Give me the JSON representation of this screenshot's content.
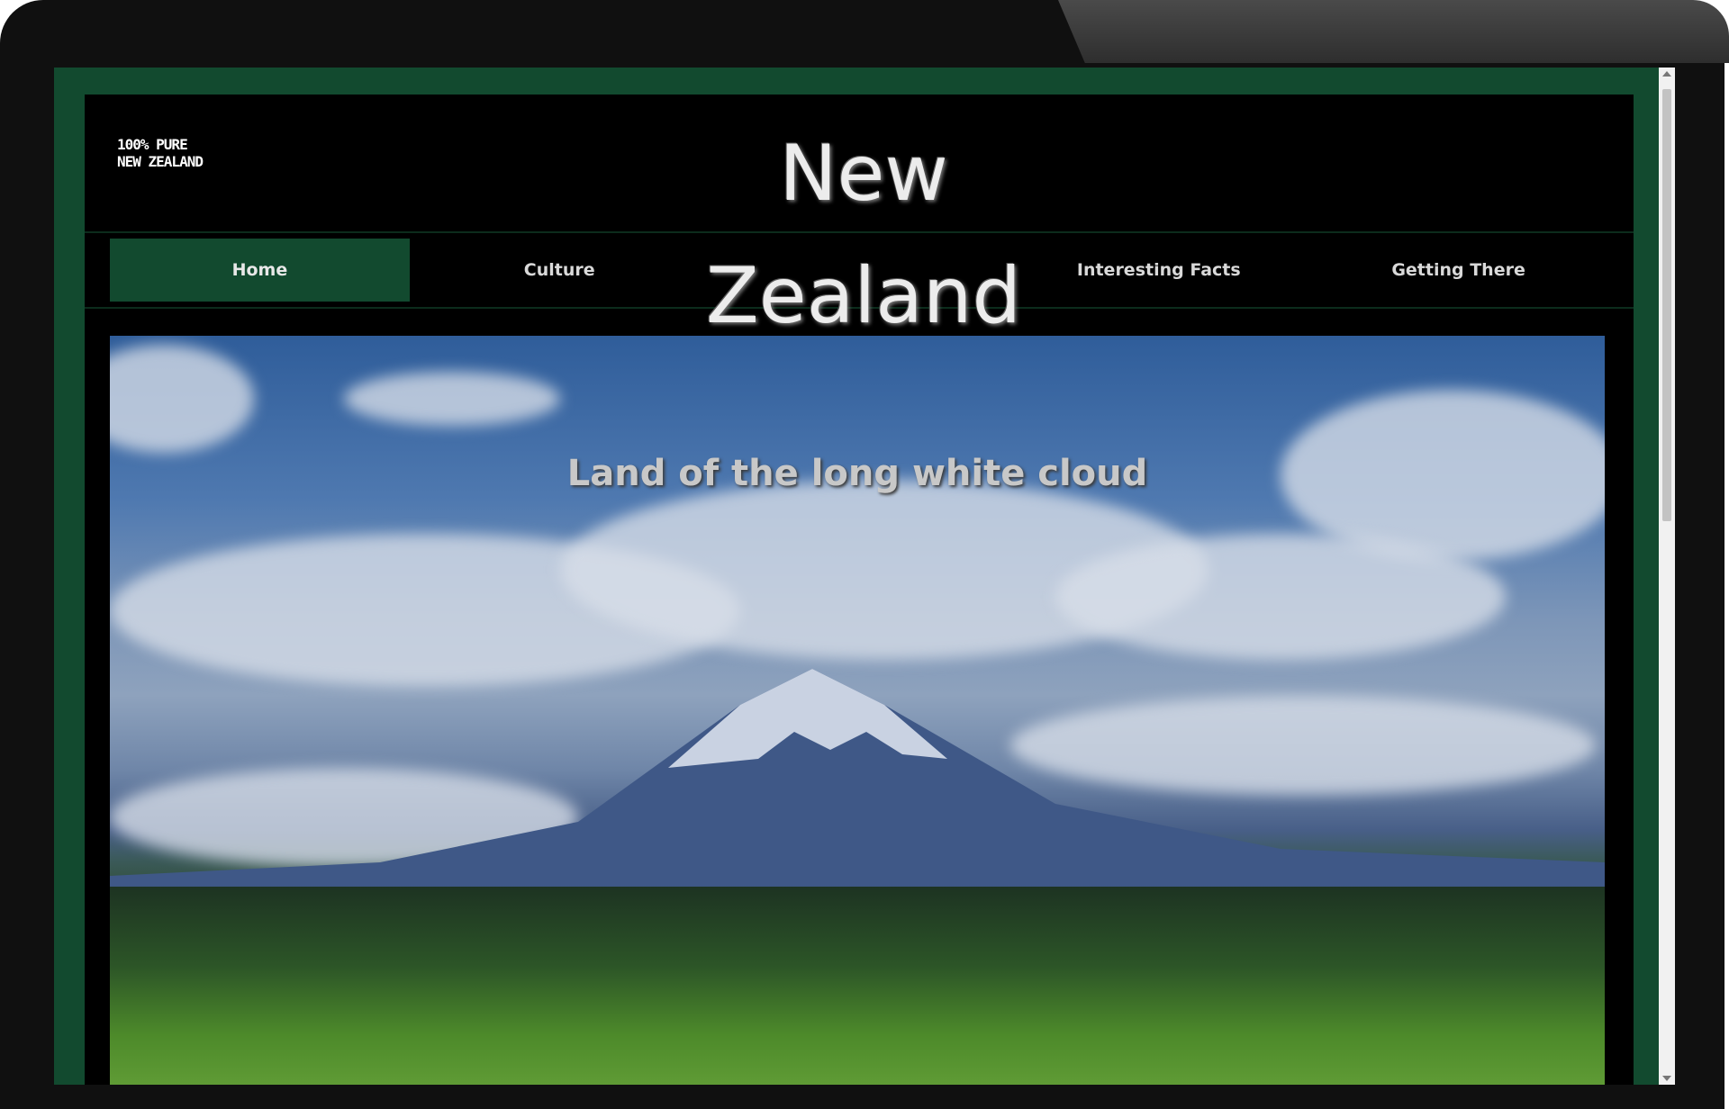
{
  "site": {
    "logo_line1": "100% PURE",
    "logo_line2": "NEW ZEALAND",
    "title": "New Zealand"
  },
  "nav": {
    "items": [
      {
        "label": "Home",
        "active": true
      },
      {
        "label": "Culture",
        "active": false
      },
      {
        "label": "",
        "active": false
      },
      {
        "label": "Interesting Facts",
        "active": false
      },
      {
        "label": "Getting There",
        "active": false
      }
    ]
  },
  "hero": {
    "tagline": "Land of the long white cloud"
  },
  "colors": {
    "accent_green": "#124a2f",
    "header_bg": "#000000",
    "bezel": "#101010"
  },
  "scrollbar": {
    "thumb_fraction": 0.44
  }
}
